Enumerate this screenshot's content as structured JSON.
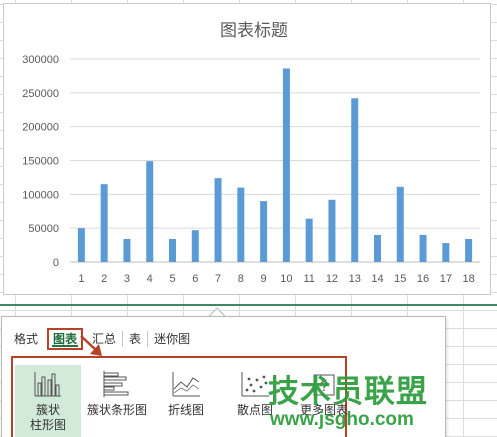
{
  "chart_data": {
    "type": "bar",
    "title": "图表标题",
    "categories": [
      "1",
      "2",
      "3",
      "4",
      "5",
      "6",
      "7",
      "8",
      "9",
      "10",
      "11",
      "12",
      "13",
      "14",
      "15",
      "16",
      "17",
      "18"
    ],
    "values": [
      50000,
      115000,
      34000,
      149000,
      34000,
      47000,
      124000,
      110000,
      90000,
      286000,
      64000,
      92000,
      242000,
      40000,
      111000,
      40000,
      28000,
      34000
    ],
    "ylim": [
      0,
      300000
    ],
    "yticks": [
      "0",
      "50000",
      "100000",
      "150000",
      "200000",
      "250000",
      "300000"
    ],
    "xlabel": "",
    "ylabel": "",
    "grid": true,
    "bar_color": "#5b9bd5"
  },
  "quick_analysis": {
    "tabs": [
      {
        "label": "格式"
      },
      {
        "label": "图表"
      },
      {
        "label": "汇总"
      },
      {
        "label": "表"
      },
      {
        "label": "迷你图"
      }
    ],
    "active_tab": "图表",
    "chart_types": [
      {
        "label": "簇状\n柱形图",
        "icon": "clustered-column-icon"
      },
      {
        "label": "簇状条形图",
        "icon": "clustered-bar-icon"
      },
      {
        "label": "折线图",
        "icon": "line-chart-icon"
      },
      {
        "label": "散点图",
        "icon": "scatter-chart-icon"
      },
      {
        "label": "更多图表",
        "icon": "more-charts-icon"
      }
    ]
  },
  "watermark": {
    "text": "技术员联盟",
    "url": "www.jsgho.com"
  },
  "colors": {
    "accent_green": "#217346",
    "highlight_red": "#b5432a",
    "bar_blue": "#5b9bd5",
    "selected_bg": "#d2ead8"
  }
}
